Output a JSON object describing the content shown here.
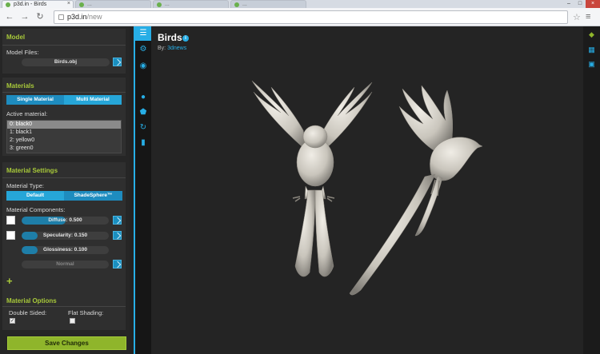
{
  "browser": {
    "tabs": [
      {
        "label": "p3d.in - Birds",
        "active": true
      },
      {
        "label": "...",
        "active": false
      },
      {
        "label": "...",
        "active": false
      },
      {
        "label": "...",
        "active": false
      }
    ],
    "url_host": "p3d.in",
    "url_path": "/new"
  },
  "panel": {
    "model": {
      "title": "Model",
      "files_label": "Model Files:",
      "file_name": "Birds.obj"
    },
    "materials": {
      "title": "Materials",
      "single_label": "Single Material",
      "multi_label": "Multi Material",
      "active_label": "Active material:",
      "items": [
        "0: black0",
        "1: black1",
        "2: yellow0",
        "3: green0"
      ],
      "selected_index": 0
    },
    "material_settings": {
      "title": "Material Settings",
      "type_label": "Material Type:",
      "default_label": "Default",
      "shadesphere_label": "ShadeSphere™",
      "components_label": "Material Components:",
      "diffuse": {
        "text": "Diffuse: 0.500",
        "value": 0.5
      },
      "specularity": {
        "text": "Specularity: 0.150",
        "value": 0.15
      },
      "glossiness": {
        "text": "Glossiness: 0.100",
        "value": 0.1
      },
      "normal_label": "Normal"
    },
    "material_options": {
      "title": "Material Options",
      "double_sided_label": "Double Sided:",
      "double_sided": true,
      "flat_shading_label": "Flat Shading:",
      "flat_shading": false
    },
    "save_label": "Save Changes"
  },
  "viewport": {
    "title": "Birds",
    "by_label": "By:",
    "author": "3dnews"
  },
  "colors": {
    "accent": "#27aee6",
    "section_title": "#a8c93a",
    "save_button": "#8fb52b"
  }
}
